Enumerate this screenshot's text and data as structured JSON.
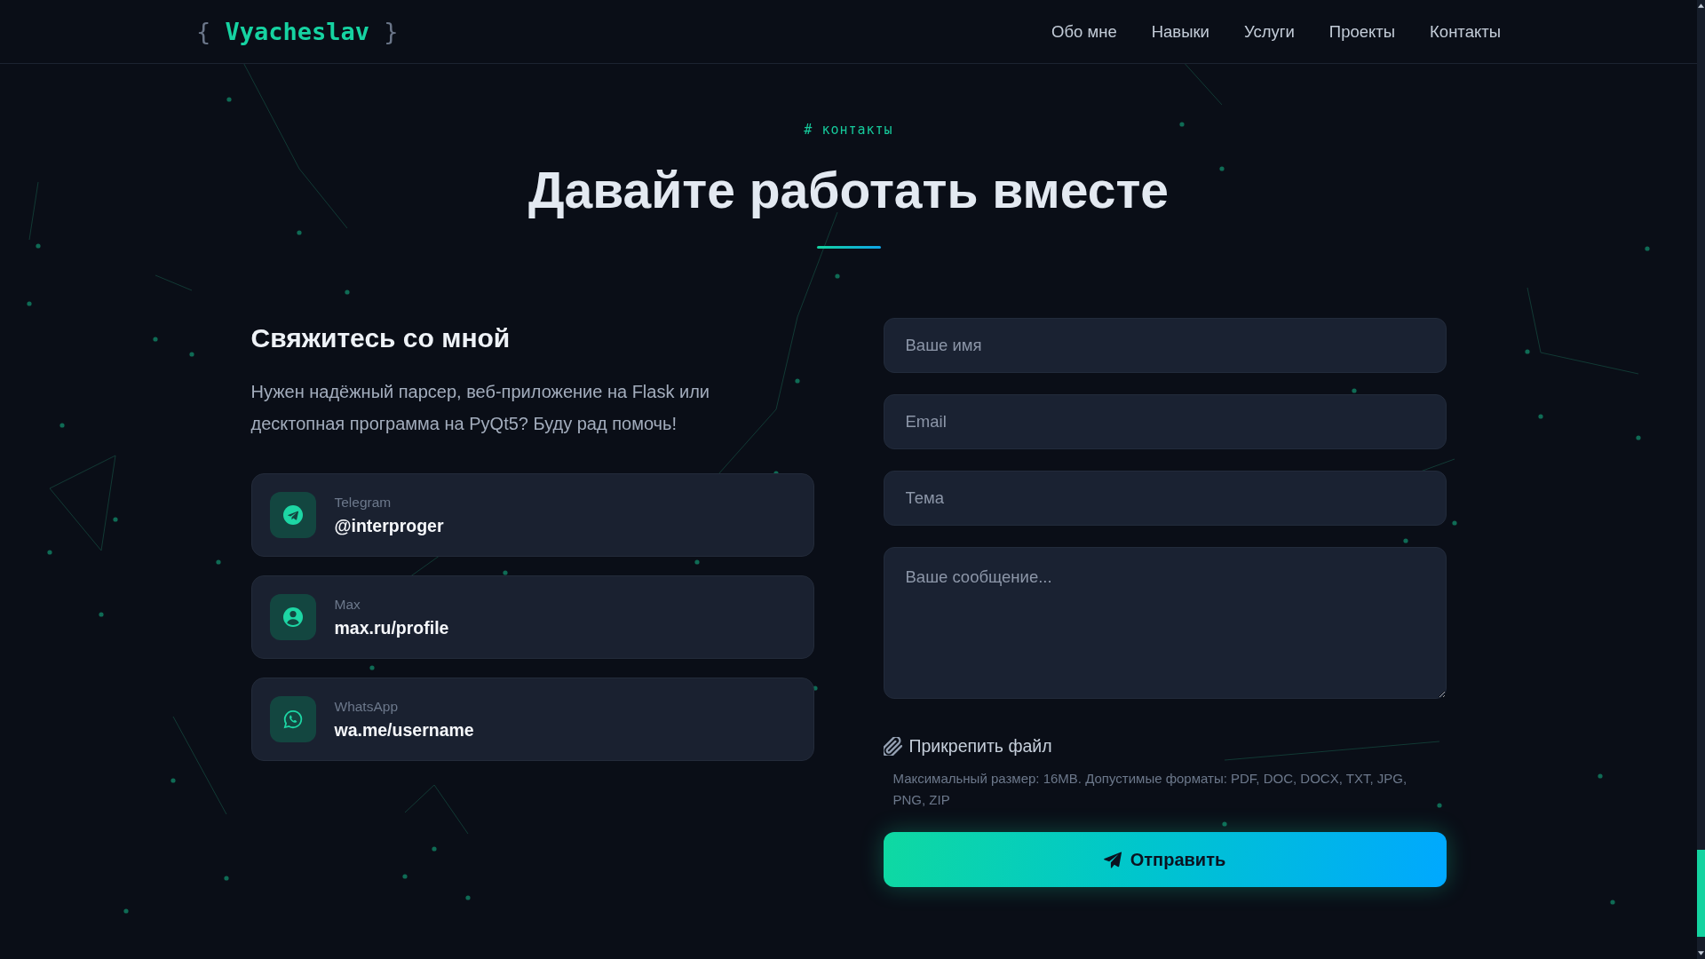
{
  "header": {
    "logo": "{ **Vyacheslav** }",
    "nav": [
      "Обо мне",
      "Навыки",
      "Услуги",
      "Проекты",
      "Контакты"
    ]
  },
  "section": {
    "tag": "# контакты",
    "title": "Давайте работать вместе"
  },
  "contact_info": {
    "heading": "Свяжитесь со мной",
    "text": "Нужен надёжный парсер, веб-приложение на Flask или десктопная программа на PyQt5? Буду рад помочь!",
    "items": [
      {
        "kind": "telegram",
        "label": "Telegram",
        "value": "@interproger"
      },
      {
        "kind": "max",
        "label": "Max",
        "value": "max.ru/profile"
      },
      {
        "kind": "whatsapp",
        "label": "WhatsApp",
        "value": "wa.me/username"
      }
    ]
  },
  "form": {
    "fields": [
      {
        "kind": "input",
        "placeholder": "Ваше имя"
      },
      {
        "kind": "input",
        "placeholder": "Email"
      },
      {
        "kind": "input",
        "placeholder": "Тема"
      },
      {
        "kind": "textarea",
        "placeholder": "Ваше сообщение..."
      }
    ],
    "attach": {
      "label": "Прикрепить файл",
      "hint": "Максимальный размер: 16MB. Допустимые форматы: PDF, DOC, DOCX, TXT, JPG, PNG, ZIP"
    },
    "submit": "Отправить"
  }
}
